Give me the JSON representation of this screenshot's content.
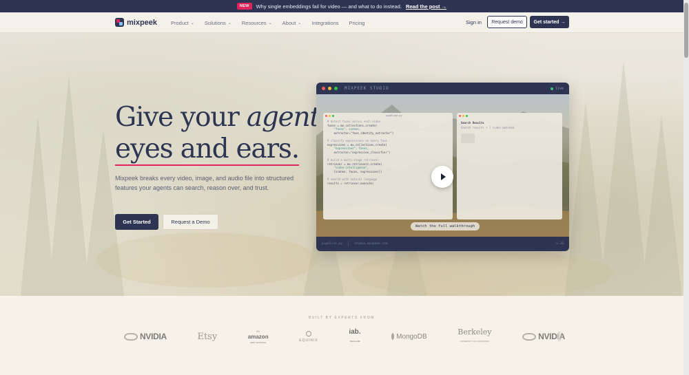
{
  "announcement": {
    "badge": "NEW",
    "text": "Why single embeddings fail for video — and what to do instead.",
    "link": "Read the post →"
  },
  "nav": {
    "logo": "mixpeek",
    "menu": [
      {
        "label": "Product",
        "chevron": true
      },
      {
        "label": "Solutions",
        "chevron": true
      },
      {
        "label": "Resources",
        "chevron": true
      },
      {
        "label": "About",
        "chevron": true
      },
      {
        "label": "Integrations",
        "chevron": false
      },
      {
        "label": "Pricing",
        "chevron": false
      }
    ],
    "sign_in": "Sign in",
    "request_demo": "Request demo",
    "get_started": "Get started →"
  },
  "hero": {
    "headline_plain_1": "Give your ",
    "headline_italic": "agents",
    "headline_line_2": "eyes and ears.",
    "subtitle": "Mixpeek breaks every video, image, and audio file into structured features your agents can search, reason over, and trust.",
    "cta_primary": "Get Started",
    "cta_secondary": "Request a Demo"
  },
  "studio": {
    "title": "MIXPEEK STUDIO",
    "status": "live",
    "editor_title": "pipeline.py",
    "results_title": "Search Results",
    "results_line": "Search results • 1 video matched",
    "code": [
      {
        "t": "c",
        "v": "# detect faces across each video"
      },
      {
        "t": "n",
        "v": "faces = mx.collections.create("
      },
      {
        "t": "s",
        "v": "    \"faces\", scenes,"
      },
      {
        "t": "n",
        "v": "    extractor=\"face_identity_extractor\")"
      },
      {
        "t": "n",
        "v": " "
      },
      {
        "t": "c",
        "v": "# classify expressions on every face"
      },
      {
        "t": "n",
        "v": "expressions = mx.collections.create("
      },
      {
        "t": "s",
        "v": "    \"expressions\", faces,"
      },
      {
        "t": "n",
        "v": "    extractor=\"expression_classifier\")"
      },
      {
        "t": "n",
        "v": " "
      },
      {
        "t": "c",
        "v": "# build a multi-stage retriever"
      },
      {
        "t": "n",
        "v": "retriever = mx.retrievers.create("
      },
      {
        "t": "s",
        "v": "    \"video-intelligence\","
      },
      {
        "t": "n",
        "v": "    [scenes, faces, expressions])"
      },
      {
        "t": "n",
        "v": " "
      },
      {
        "t": "c",
        "v": "# search with natural language"
      },
      {
        "t": "n",
        "v": "results = retriever.execute("
      }
    ],
    "watch": "Watch the full walkthrough",
    "footer_file": "pipeline.py",
    "footer_url": "studio.mixpeek.com",
    "footer_version": "v.10"
  },
  "logos": {
    "heading": "BUILT BY EXPERTS FROM",
    "items": [
      "NVIDIA",
      "Etsy",
      "amazon",
      "EQUINIX",
      "iab.",
      "MongoDB",
      "Berkeley",
      "NVIDIA"
    ],
    "amazon_top": "Ex",
    "amazon_bottom": "web services",
    "iab_sub": "TECH LAB",
    "berkeley_sub": "UNIVERSITY OF CALIFORNIA"
  },
  "colors": {
    "navy": "#2d3553",
    "accent_pink": "#e0245e",
    "cream": "#f6f2ea"
  }
}
